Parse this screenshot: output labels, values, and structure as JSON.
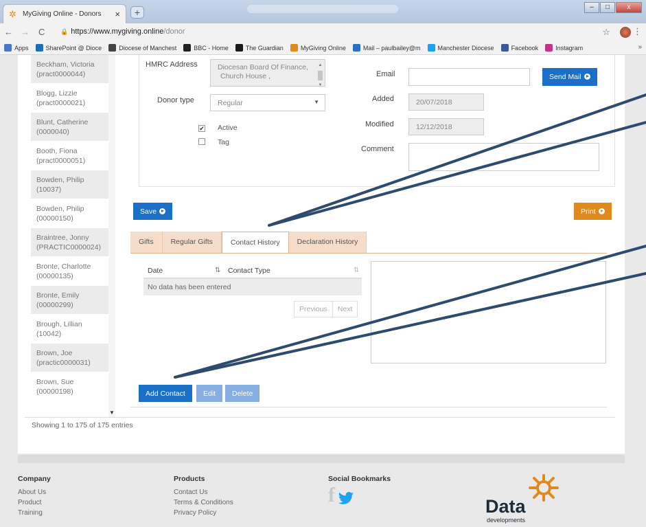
{
  "browser": {
    "tab_title": "MyGiving Online - Donors",
    "tab_close": "×",
    "new_tab": "+",
    "url_host": "https://www.mygiving.online",
    "url_path": "/donor",
    "bookmarks": [
      {
        "label": "Apps",
        "color": "#4a78c4"
      },
      {
        "label": "SharePoint @ Dioce",
        "color": "#1c6fb5"
      },
      {
        "label": "Diocese of Manchest",
        "color": "#444444"
      },
      {
        "label": "BBC - Home",
        "color": "#222222"
      },
      {
        "label": "The Guardian",
        "color": "#1a1a1a"
      },
      {
        "label": "MyGiving Online",
        "color": "#e08a1e"
      },
      {
        "label": "Mail – paulbailey@m",
        "color": "#2f6fbf"
      },
      {
        "label": "Manchester Diocese",
        "color": "#1da1f2"
      },
      {
        "label": "Facebook",
        "color": "#3b5998"
      },
      {
        "label": "Instagram",
        "color": "#c13584"
      }
    ],
    "bookmarks_more": "»"
  },
  "donors": [
    {
      "name": "Beckham, Victoria",
      "ref": "(pract0000044)"
    },
    {
      "name": "Blogg, Lizzie",
      "ref": "(pract0000021)"
    },
    {
      "name": "Blunt, Catherine",
      "ref": "(0000040)"
    },
    {
      "name": "Booth, Fiona",
      "ref": "(pract0000051)"
    },
    {
      "name": "Bowden, Philip",
      "ref": "(10037)"
    },
    {
      "name": "Bowden, Philip",
      "ref": "(00000150)"
    },
    {
      "name": "Braintree, Jonny",
      "ref": "(PRACTIC0000024)"
    },
    {
      "name": "Bronte, Charlotte",
      "ref": "(00000135)"
    },
    {
      "name": "Bronte, Emily",
      "ref": "(00000299)"
    },
    {
      "name": "Brough, Lillian",
      "ref": "(10042)"
    },
    {
      "name": "Brown, Joe",
      "ref": "(practic0000031)"
    },
    {
      "name": "Brown, Sue",
      "ref": "(00000198)"
    }
  ],
  "list_footer": "Showing 1 to 175 of 175 entries",
  "form": {
    "hmrc_label": "HMRC Address",
    "hmrc_line1": "Diocesan Board Of Finance,",
    "hmrc_line2": "Church House ,",
    "donor_type_label": "Donor type",
    "donor_type_value": "Regular",
    "active_label": "Active",
    "active_mark": "✔",
    "tag_label": "Tag",
    "email_label": "Email",
    "email_value": "",
    "send_mail": "Send Mail",
    "added_label": "Added",
    "added_value": "20/07/2018",
    "modified_label": "Modified",
    "modified_value": "12/12/2018",
    "comment_label": "Comment",
    "comment_value": ""
  },
  "actions": {
    "save": "Save",
    "print": "Print"
  },
  "tabs": [
    {
      "label": "Gifts",
      "active": false
    },
    {
      "label": "Regular Gifts",
      "active": false
    },
    {
      "label": "Contact History",
      "active": true
    },
    {
      "label": "Declaration History",
      "active": false
    }
  ],
  "contact_table": {
    "col_date": "Date",
    "col_type": "Contact Type",
    "empty": "No data has been entered",
    "prev": "Previous",
    "next": "Next"
  },
  "contact_buttons": {
    "add": "Add Contact",
    "edit": "Edit",
    "delete": "Delete"
  },
  "footer": {
    "company": {
      "title": "Company",
      "links": [
        "About Us",
        "Product",
        "Training"
      ]
    },
    "products": {
      "title": "Products",
      "links": [
        "Contact Us",
        "Terms & Conditions",
        "Privacy Policy"
      ]
    },
    "social": {
      "title": "Social Bookmarks"
    },
    "logo_word": "Data",
    "logo_sub": "developments"
  },
  "colors": {
    "primary": "#1a6fc7",
    "print": "#e08a1e",
    "tab": "#f5ddc9",
    "arrow": "#2e4a6d"
  }
}
